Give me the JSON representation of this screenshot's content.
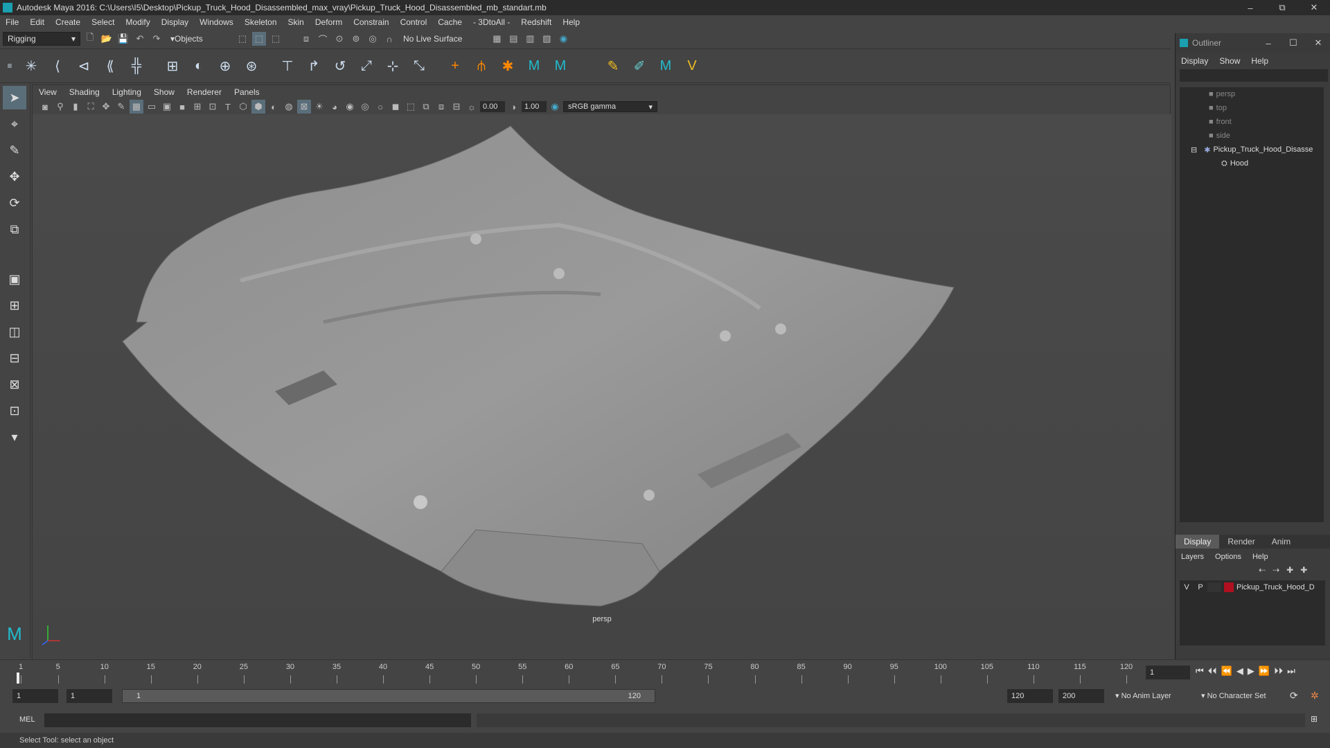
{
  "window": {
    "title": "Autodesk Maya 2016: C:\\Users\\I5\\Desktop\\Pickup_Truck_Hood_Disassembled_max_vray\\Pickup_Truck_Hood_Disassembled_mb_standart.mb",
    "minimize": "–",
    "maximize": "⧉",
    "close": "✕"
  },
  "menubar": [
    "File",
    "Edit",
    "Create",
    "Select",
    "Modify",
    "Display",
    "Windows",
    "Skeleton",
    "Skin",
    "Deform",
    "Constrain",
    "Control",
    "Cache",
    "- 3DtoAll -",
    "Redshift",
    "Help"
  ],
  "statusline": {
    "menuset": "Rigging",
    "select_mode": "Objects",
    "live_surface": "No Live Surface"
  },
  "viewport": {
    "menu": [
      "View",
      "Shading",
      "Lighting",
      "Show",
      "Renderer",
      "Panels"
    ],
    "exposure": "0.00",
    "gamma": "1.00",
    "color_space": "sRGB gamma",
    "camera": "persp"
  },
  "outliner": {
    "title": "Outliner",
    "menu": [
      "Display",
      "Show",
      "Help"
    ],
    "items": [
      {
        "label": "persp",
        "selected": false
      },
      {
        "label": "top",
        "selected": false
      },
      {
        "label": "front",
        "selected": false
      },
      {
        "label": "side",
        "selected": false
      },
      {
        "label": "Pickup_Truck_Hood_Disasse",
        "selected": true
      },
      {
        "label": "Hood",
        "selected": true
      }
    ]
  },
  "layer_editor": {
    "tabs": [
      "Display",
      "Render",
      "Anim"
    ],
    "active_tab": "Display",
    "menu": [
      "Layers",
      "Options",
      "Help"
    ],
    "layer": {
      "v": "V",
      "p": "P",
      "name": "Pickup_Truck_Hood_D",
      "color": "#b01020"
    }
  },
  "timeline": {
    "ticks": [
      1,
      5,
      10,
      15,
      20,
      25,
      30,
      35,
      40,
      45,
      50,
      55,
      60,
      65,
      70,
      75,
      80,
      85,
      90,
      95,
      100,
      105,
      110,
      115,
      120
    ],
    "current_frame": "1"
  },
  "range": {
    "start": "1",
    "playback_start": "1",
    "slider_start": "1",
    "slider_end": "120",
    "playback_end": "120",
    "end": "200",
    "anim_layer": "No Anim Layer",
    "character_set": "No Character Set"
  },
  "cmdline": {
    "label": "MEL"
  },
  "helpline": {
    "text": "Select Tool: select an object"
  }
}
